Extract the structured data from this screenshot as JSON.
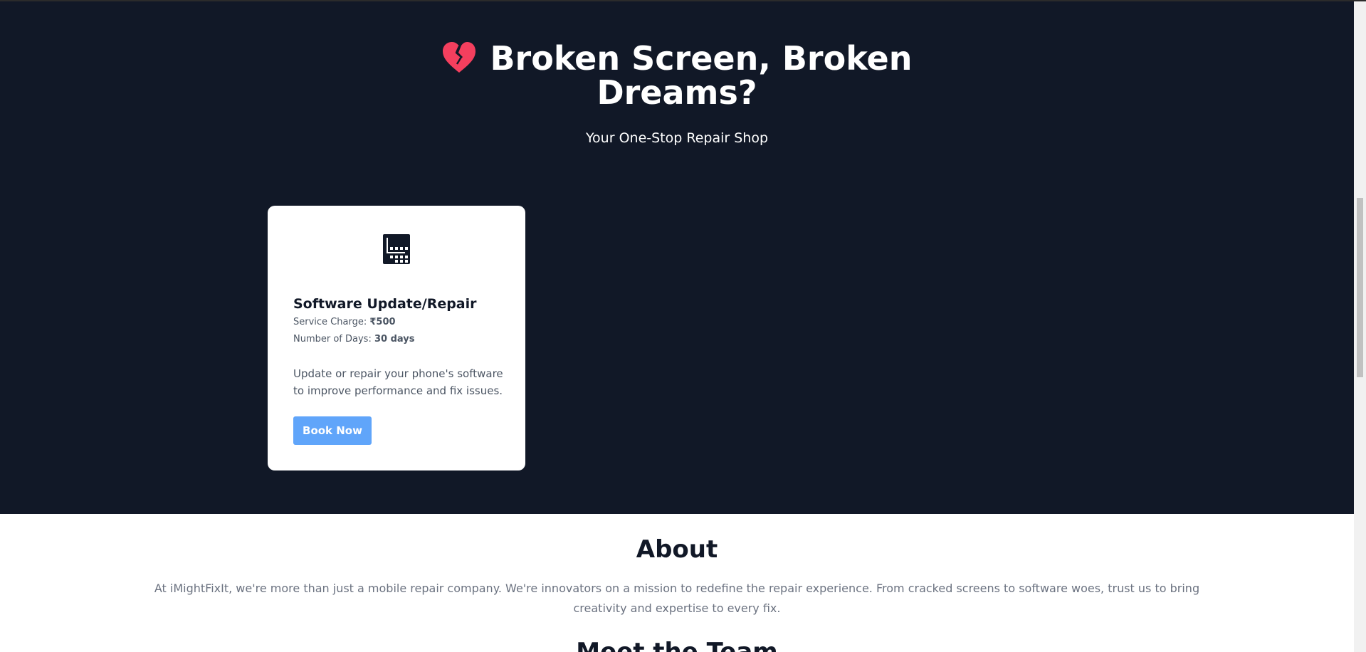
{
  "hero": {
    "title_line1": "Broken Screen, Broken",
    "title_line2": "Dreams?",
    "subtitle": "Your One-Stop Repair Shop",
    "heart_color": "#f43f5e",
    "background": "#111827"
  },
  "service": {
    "icon": "software-chip-icon",
    "title": "Software Update/Repair",
    "charge_label": "Service Charge:",
    "charge_value": "₹500",
    "days_label": "Number of Days:",
    "days_value": "30 days",
    "description": "Update or repair your phone's software to improve performance and fix issues.",
    "button_label": "Book Now",
    "button_color": "#60a5fa"
  },
  "about": {
    "title": "About",
    "text": "At iMightFixIt, we're more than just a mobile repair company. We're innovators on a mission to redefine the repair experience. From cracked screens to software woes, trust us to bring creativity and expertise to every fix."
  },
  "team": {
    "title": "Meet the Team"
  }
}
